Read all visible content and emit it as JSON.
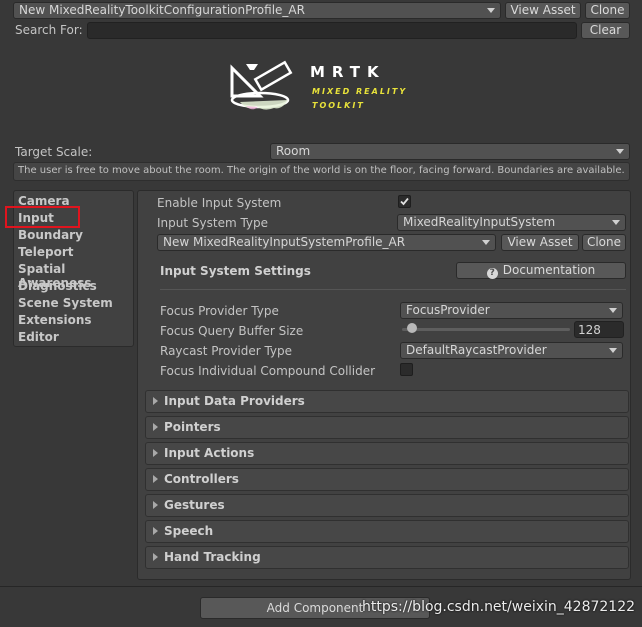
{
  "profile": {
    "selected": "New MixedRealityToolkitConfigurationProfile_AR",
    "view_asset": "View Asset",
    "clone": "Clone"
  },
  "search": {
    "label": "Search For:",
    "value": "",
    "clear": "Clear"
  },
  "logo": {
    "title": "MRTK",
    "subtitle_line1": "MIXED REALITY",
    "subtitle_line2": "TOOLKIT"
  },
  "target_scale": {
    "label": "Target Scale:",
    "value": "Room",
    "help": "The user is free to move about the room. The origin of the world is on the floor, facing forward. Boundaries are available."
  },
  "sidebar": {
    "items": [
      {
        "label": "Camera"
      },
      {
        "label": "Input",
        "selected": true
      },
      {
        "label": "Boundary"
      },
      {
        "label": "Teleport"
      },
      {
        "label": "Spatial Awareness"
      },
      {
        "label": "Diagnostics"
      },
      {
        "label": "Scene System"
      },
      {
        "label": "Extensions"
      },
      {
        "label": "Editor"
      }
    ]
  },
  "input": {
    "enable_label": "Enable Input System",
    "enable_checked": true,
    "system_type_label": "Input System Type",
    "system_type_value": "MixedRealityInputSystem",
    "profile_value": "New MixedRealityInputSystemProfile_AR",
    "view_asset": "View Asset",
    "clone": "Clone",
    "settings_title": "Input System Settings",
    "documentation": "Documentation",
    "focus_provider_label": "Focus Provider Type",
    "focus_provider_value": "FocusProvider",
    "buffer_label": "Focus Query Buffer Size",
    "buffer_value": "128",
    "buffer_slider_fraction": 0.03,
    "raycast_label": "Raycast Provider Type",
    "raycast_value": "DefaultRaycastProvider",
    "compound_label": "Focus Individual Compound Collider",
    "compound_checked": false
  },
  "sections": [
    {
      "label": "Input Data Providers"
    },
    {
      "label": "Pointers"
    },
    {
      "label": "Input Actions"
    },
    {
      "label": "Controllers"
    },
    {
      "label": "Gestures"
    },
    {
      "label": "Speech"
    },
    {
      "label": "Hand Tracking"
    }
  ],
  "footer": {
    "add_component": "Add Component",
    "watermark": "https://blog.csdn.net/weixin_42872122"
  },
  "colors": {
    "highlight_box": "#e0141e",
    "logo_yellow": "#e8e23a"
  }
}
